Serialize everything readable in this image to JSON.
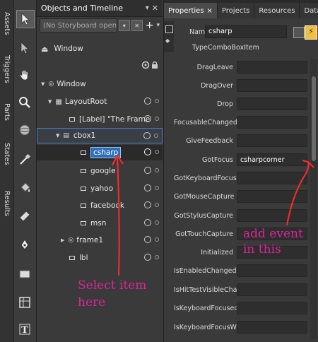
{
  "left_tabs": [
    "Assets",
    "Triggers",
    "Parts",
    "States",
    "Results"
  ],
  "objects_panel": {
    "title": "Objects and Timeline",
    "storyboard_placeholder": "(No Storyboard open)",
    "scope_label": "Window",
    "tree": [
      {
        "label": "Window"
      },
      {
        "label": "LayoutRoot"
      },
      {
        "label": "[Label] \"The Frame"
      },
      {
        "label": "cbox1"
      },
      {
        "label": "csharp"
      },
      {
        "label": "google"
      },
      {
        "label": "yahoo"
      },
      {
        "label": "facebook"
      },
      {
        "label": "msn"
      },
      {
        "label": "frame1"
      },
      {
        "label": "lbl"
      }
    ]
  },
  "properties_panel": {
    "tabs": [
      "Properties",
      "Projects",
      "Resources",
      "Data"
    ],
    "name_label": "Name",
    "name_value": "csharp",
    "type_label": "Type",
    "type_value": "ComboBoxItem",
    "events": [
      {
        "name": "DragLeave",
        "value": ""
      },
      {
        "name": "DragOver",
        "value": ""
      },
      {
        "name": "Drop",
        "value": ""
      },
      {
        "name": "FocusableChanged",
        "value": ""
      },
      {
        "name": "GiveFeedback",
        "value": ""
      },
      {
        "name": "GotFocus",
        "value": "csharpcorner"
      },
      {
        "name": "GotKeyboardFocus",
        "value": ""
      },
      {
        "name": "GotMouseCapture",
        "value": ""
      },
      {
        "name": "GotStylusCapture",
        "value": ""
      },
      {
        "name": "GotTouchCapture",
        "value": ""
      },
      {
        "name": "Initialized",
        "value": ""
      },
      {
        "name": "IsEnabledChanged",
        "value": ""
      },
      {
        "name": "IsHitTestVisibleChang...",
        "value": ""
      },
      {
        "name": "IsKeyboardFocusedC...",
        "value": ""
      },
      {
        "name": "IsKeyboardFocusWith...",
        "value": ""
      }
    ]
  },
  "annotations": {
    "select_item": "Select item here",
    "add_event": "add event in this"
  },
  "colors": {
    "annotation": "#e0239b",
    "selection": "#2f6fb7",
    "arrow": "#ff2a2a"
  }
}
